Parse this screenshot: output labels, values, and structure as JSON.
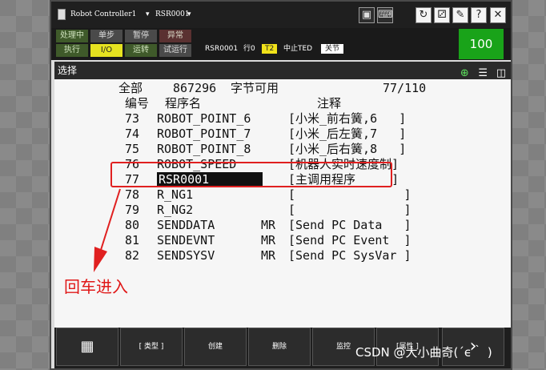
{
  "window": {
    "title_left": "Robot Controller1",
    "title_program": "RSR0001",
    "dropdown_glyph": "▾"
  },
  "status": {
    "leds": [
      "处理中",
      "单步",
      "暂停",
      "异常",
      "执行",
      "I/O",
      "运转",
      "试运行"
    ],
    "program": "RSR0001",
    "line": "行0",
    "t2": "T2",
    "stop": "中止TED",
    "joint": "关节",
    "override": "100"
  },
  "screen": {
    "title": "选择",
    "summary_label": "全部",
    "bytes_free": "867296",
    "bytes_label": "字节可用",
    "position": "77/110",
    "col_no": "编号",
    "col_name": "程序名",
    "col_comment": "注释"
  },
  "programs": [
    {
      "no": "73",
      "name": "ROBOT_POINT_6",
      "attr": "",
      "comment": "[小米_前右簧,6   ]"
    },
    {
      "no": "74",
      "name": "ROBOT_POINT_7",
      "attr": "",
      "comment": "[小米_后左簧,7   ]"
    },
    {
      "no": "75",
      "name": "ROBOT_POINT_8",
      "attr": "",
      "comment": "[小米_后右簧,8   ]"
    },
    {
      "no": "76",
      "name": "ROBOT_SPEED",
      "attr": "",
      "comment": "[机器人实时速度制]"
    },
    {
      "no": "77",
      "name": "RSR0001",
      "attr": "",
      "comment": "[主调用程序     ]"
    },
    {
      "no": "78",
      "name": "R_NG1",
      "attr": "",
      "comment": "[               ]"
    },
    {
      "no": "79",
      "name": "R_NG2",
      "attr": "",
      "comment": "[               ]"
    },
    {
      "no": "80",
      "name": "SENDDATA",
      "attr": "MR",
      "comment": "[Send PC Data   ]"
    },
    {
      "no": "81",
      "name": "SENDEVNT",
      "attr": "MR",
      "comment": "[Send PC Event  ]"
    },
    {
      "no": "82",
      "name": "SENDSYSV",
      "attr": "MR",
      "comment": "[Send PC SysVar ]"
    }
  ],
  "annotation": "回车进入",
  "fkeys": [
    "[ 类型 ]",
    "创建",
    "删除",
    "监控",
    "[属性 ]"
  ],
  "watermark": "CSDN @大小曲奇(´ϵ｀ )",
  "colors": {
    "annotation_red": "#e02020",
    "override_green": "#19a319",
    "t2_yellow": "#f1e21a"
  }
}
